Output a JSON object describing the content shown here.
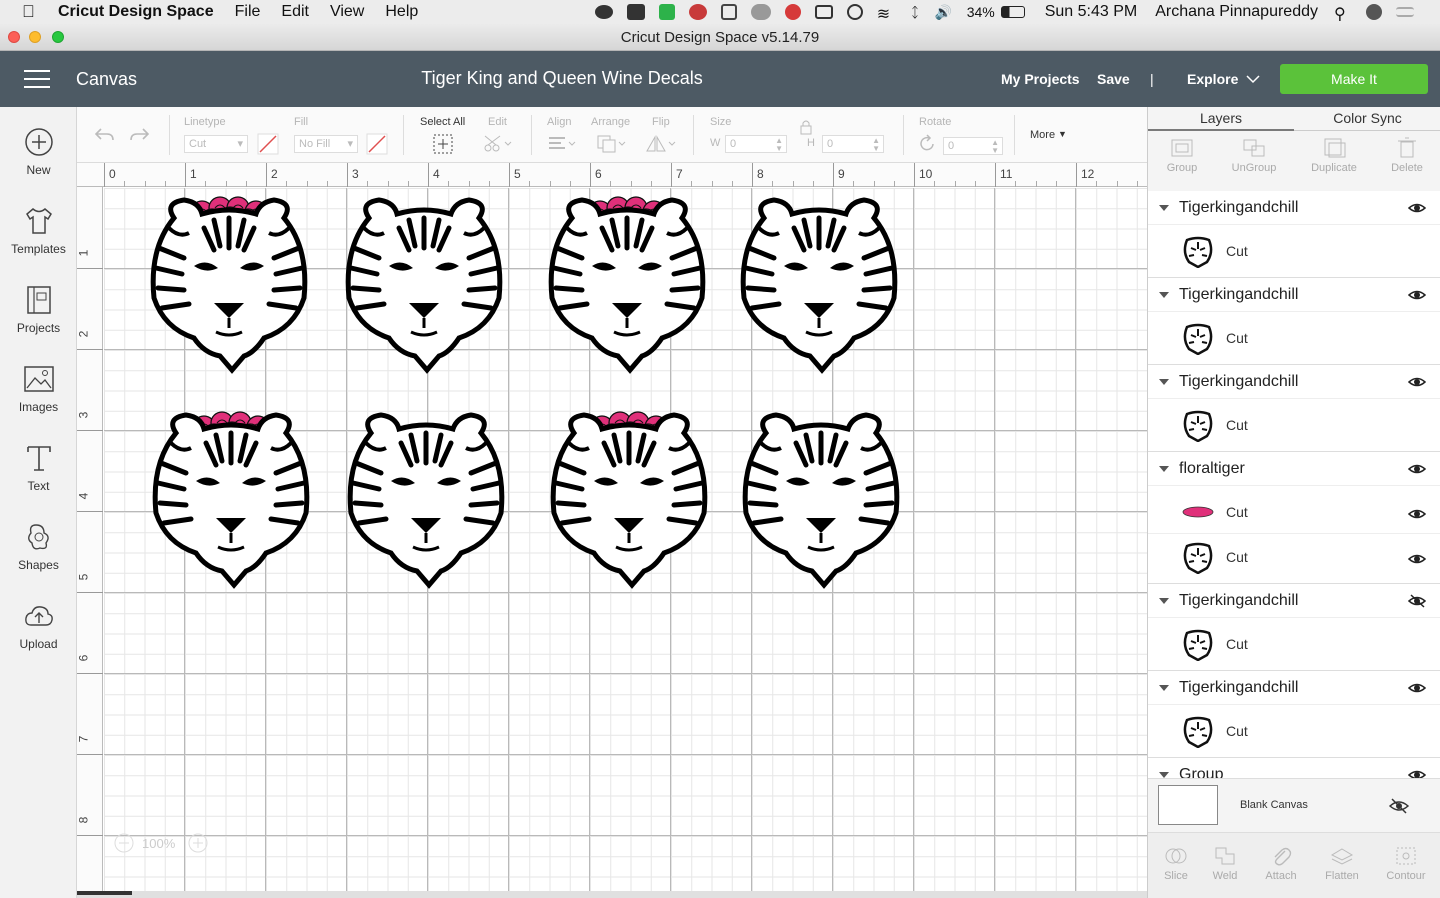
{
  "menubar": {
    "app_name": "Cricut Design Space",
    "menus": [
      "File",
      "Edit",
      "View",
      "Help"
    ],
    "battery": "34%",
    "clock": "Sun 5:43 PM",
    "user": "Archana Pinnapureddy"
  },
  "window": {
    "title": "Cricut Design Space  v5.14.79"
  },
  "header": {
    "section": "Canvas",
    "project_title": "Tiger King and Queen Wine Decals",
    "my_projects": "My Projects",
    "save": "Save",
    "separator": "|",
    "explore": "Explore",
    "make_it": "Make It",
    "accent": "#5bc23a",
    "bg": "#4d5a64"
  },
  "sidebar": {
    "items": [
      {
        "label": "New",
        "icon": "plus-circle-icon"
      },
      {
        "label": "Templates",
        "icon": "tshirt-icon"
      },
      {
        "label": "Projects",
        "icon": "projects-icon"
      },
      {
        "label": "Images",
        "icon": "image-icon"
      },
      {
        "label": "Text",
        "icon": "text-icon"
      },
      {
        "label": "Shapes",
        "icon": "shapes-icon"
      },
      {
        "label": "Upload",
        "icon": "upload-icon"
      }
    ]
  },
  "toolbar": {
    "linetype_label": "Linetype",
    "linetype_value": "Cut",
    "fill_label": "Fill",
    "fill_value": "No Fill",
    "select_all": "Select All",
    "edit": "Edit",
    "align": "Align",
    "arrange": "Arrange",
    "flip": "Flip",
    "size": "Size",
    "w_label": "W",
    "w_value": "0",
    "h_label": "H",
    "h_value": "0",
    "rotate": "Rotate",
    "rotate_value": "0",
    "more": "More"
  },
  "canvas": {
    "ruler_x": [
      "0",
      "1",
      "2",
      "3",
      "4",
      "5",
      "6",
      "7",
      "8",
      "9",
      "10",
      "11",
      "12"
    ],
    "ruler_y": [
      "1",
      "2",
      "3",
      "4",
      "5",
      "6",
      "7",
      "8"
    ],
    "zoom": "100%",
    "tiger_rows": [
      [
        {
          "flowers": true
        },
        {
          "flowers": false
        },
        {
          "flowers": true
        },
        {
          "flowers": false
        }
      ],
      [
        {
          "flowers": true
        },
        {
          "flowers": false
        },
        {
          "flowers": true
        },
        {
          "flowers": false
        }
      ]
    ],
    "flower_color": "#e0307a"
  },
  "panel": {
    "tabs": [
      "Layers",
      "Color Sync"
    ],
    "actions": [
      "Group",
      "UnGroup",
      "Duplicate",
      "Delete"
    ],
    "layers": [
      {
        "name": "Tigerkingandchill",
        "visible": true,
        "items": [
          "Cut"
        ]
      },
      {
        "name": "Tigerkingandchill",
        "visible": true,
        "items": [
          "Cut"
        ]
      },
      {
        "name": "Tigerkingandchill",
        "visible": true,
        "items": [
          "Cut"
        ]
      },
      {
        "name": "floraltiger",
        "visible": true,
        "items": [
          "Cut",
          "Cut"
        ]
      },
      {
        "name": "Tigerkingandchill",
        "visible": false,
        "items": [
          "Cut"
        ]
      },
      {
        "name": "Tigerkingandchill",
        "visible": true,
        "items": [
          "Cut"
        ]
      },
      {
        "name": "Group",
        "visible": true,
        "items": []
      }
    ],
    "blank_canvas": "Blank Canvas",
    "bottom_actions": [
      "Slice",
      "Weld",
      "Attach",
      "Flatten",
      "Contour"
    ]
  }
}
